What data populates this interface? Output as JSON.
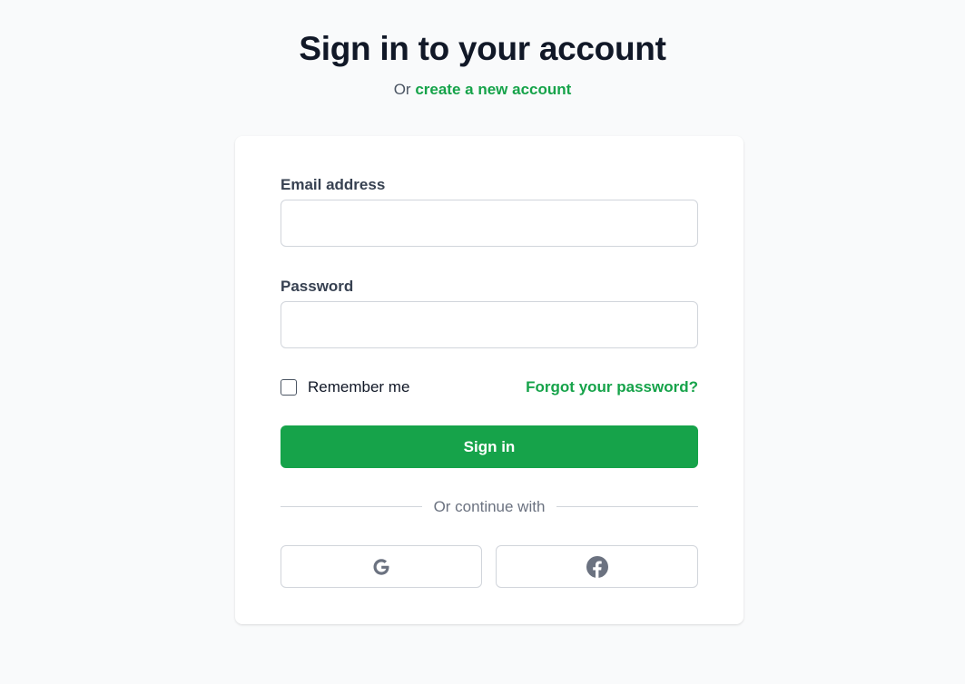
{
  "header": {
    "title": "Sign in to your account",
    "subtitle_prefix": "Or",
    "create_account_link": "create a new account"
  },
  "form": {
    "email_label": "Email address",
    "email_value": "",
    "password_label": "Password",
    "password_value": "",
    "remember_label": "Remember me",
    "remember_checked": false,
    "forgot_link": "Forgot your password?",
    "submit_label": "Sign in",
    "divider_text": "Or continue with"
  },
  "social": [
    {
      "icon": "google-icon"
    },
    {
      "icon": "facebook-icon"
    }
  ],
  "colors": {
    "accent": "#16a34a",
    "background": "#f9fafb",
    "icon_gray": "#6b7280"
  }
}
